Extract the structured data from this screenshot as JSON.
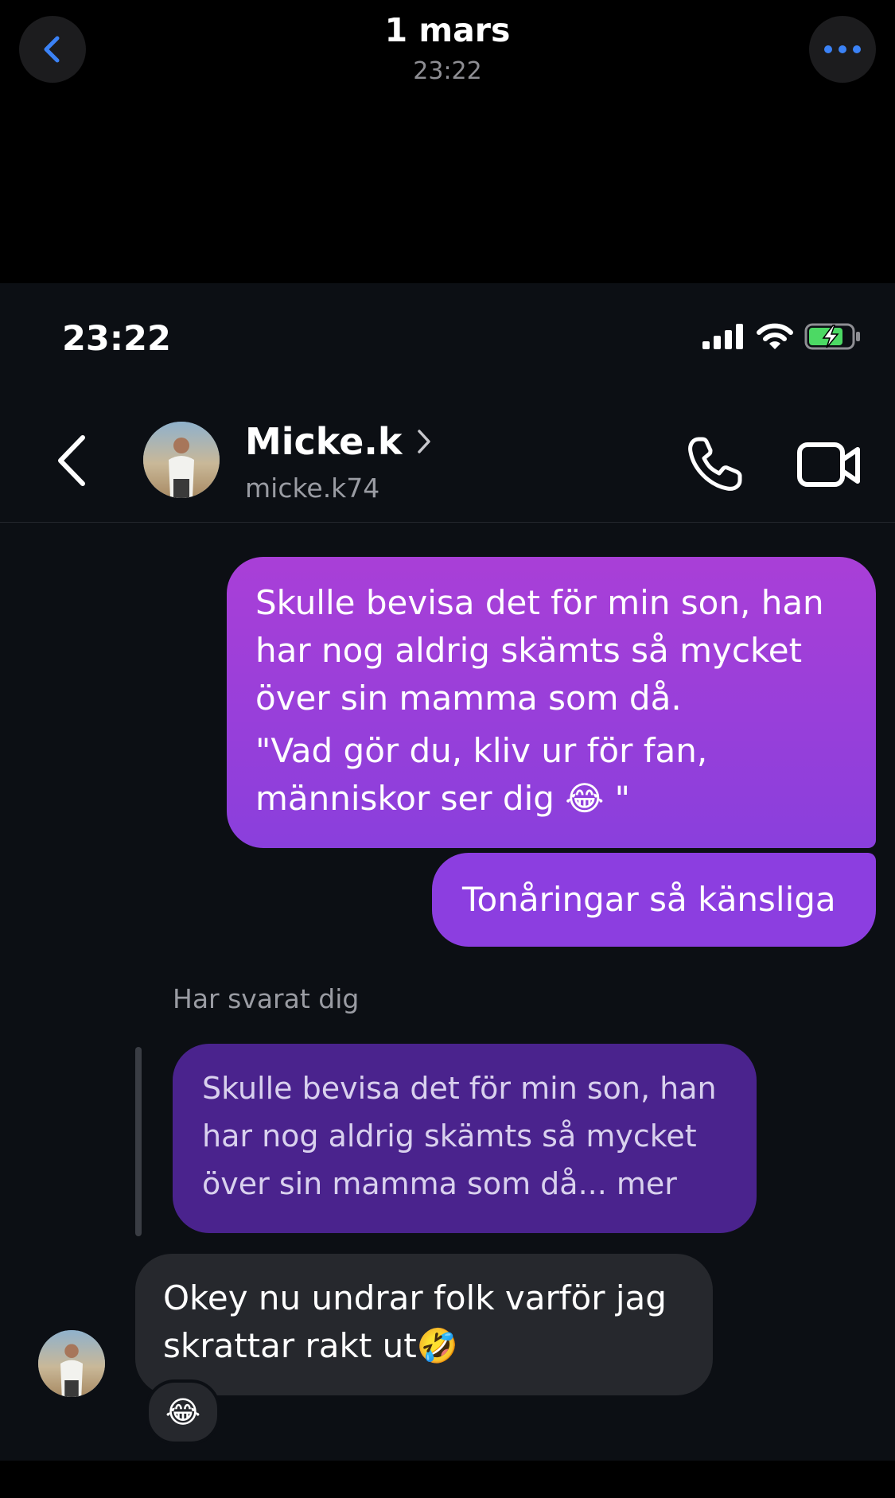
{
  "viewer": {
    "date": "1 mars",
    "time": "23:22"
  },
  "status_bar": {
    "time": "23:22"
  },
  "header": {
    "contact_name": "Micke.k",
    "contact_handle": "micke.k74"
  },
  "messages": {
    "outgoing_1": {
      "lines": [
        "Skulle bevisa det för min son, han",
        "har nog aldrig skämts så mycket",
        "över sin mamma som då.",
        "\"Vad gör du, kliv ur för fan,",
        "människor ser dig 😂 \""
      ]
    },
    "outgoing_2": "Tonåringar så känsliga",
    "reply_label": "Har svarat dig",
    "quoted": {
      "lines": [
        "Skulle bevisa det för min son, han",
        "har nog aldrig skämts så mycket",
        "över sin mamma som då... mer"
      ]
    },
    "incoming": {
      "lines": [
        "Okey nu undrar folk varför jag",
        "skrattar rakt ut🤣"
      ]
    },
    "reaction": "😂"
  },
  "icons": {
    "viewer_back": "chevron-left-icon",
    "viewer_more": "more-dots-icon",
    "back": "chevron-left-icon",
    "call": "phone-icon",
    "video": "video-camera-icon",
    "signal": "cellular-signal-icon",
    "wifi": "wifi-icon",
    "battery": "battery-charging-icon"
  },
  "colors": {
    "accent_blue": "#3b82f6",
    "bubble_purple": "#8c3ee0",
    "quoted_purple": "#4a238d",
    "incoming_gray": "#26282d",
    "battery_green": "#4cd964"
  }
}
